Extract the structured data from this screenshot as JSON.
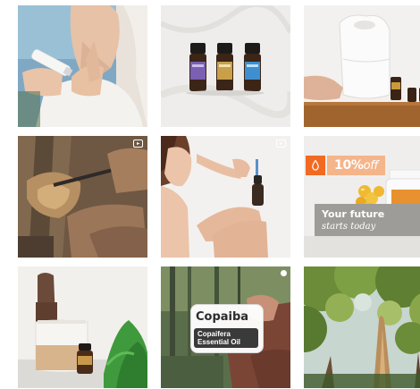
{
  "feed": {
    "tiles": [
      {
        "kind": "photo",
        "alt": "skin-care-cream"
      },
      {
        "kind": "photo",
        "alt": "three-oil-bottles"
      },
      {
        "kind": "photo",
        "alt": "diffuser"
      },
      {
        "kind": "reel",
        "alt": "tree-resin-harvest",
        "icon": "reel-icon"
      },
      {
        "kind": "reel",
        "alt": "dropper-bottle",
        "icon": "reel-icon"
      },
      {
        "kind": "promo",
        "alt": "softgel-offer"
      },
      {
        "kind": "photo",
        "alt": "diffuser-table"
      },
      {
        "kind": "carousel",
        "alt": "copaiba-forest",
        "icon": "circle-icon"
      },
      {
        "kind": "photo",
        "alt": "forest-canopy"
      }
    ]
  },
  "offer": {
    "percent": "10%",
    "suffix": "off",
    "title": "Your future",
    "subtitle": "starts today",
    "accent": "#f26a21"
  },
  "copaiba": {
    "title": "Copaiba",
    "line1": "Copaifera",
    "line2": "Essential Oil"
  }
}
